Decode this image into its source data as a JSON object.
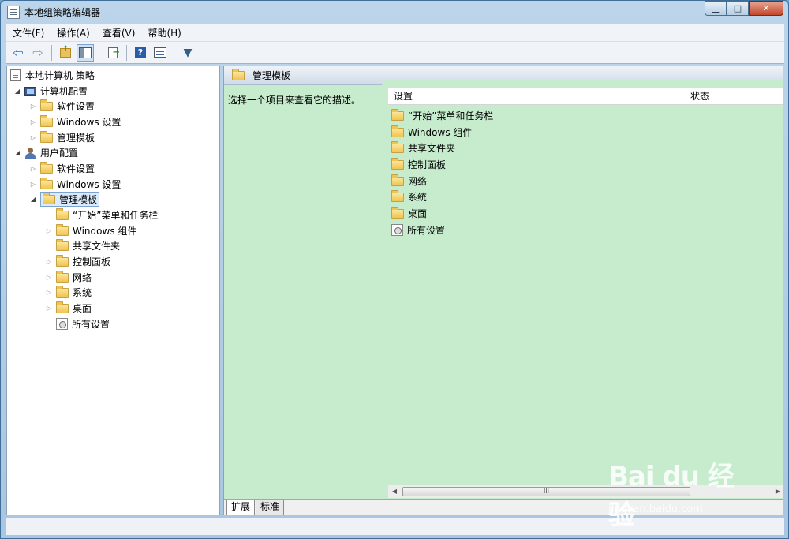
{
  "window": {
    "title": "本地组策略编辑器"
  },
  "titlebar": {
    "min": "▁",
    "max": "□",
    "close": "✕"
  },
  "menu": [
    {
      "label": "文件(F)"
    },
    {
      "label": "操作(A)"
    },
    {
      "label": "查看(V)"
    },
    {
      "label": "帮助(H)"
    }
  ],
  "toolbar": {
    "back": "⇦",
    "forward": "⇨",
    "filter": "▼"
  },
  "tree": {
    "root": "本地计算机 策略",
    "computer_config": "计算机配置",
    "cc_software": "软件设置",
    "cc_windows": "Windows 设置",
    "cc_admin": "管理模板",
    "user_config": "用户配置",
    "uc_software": "软件设置",
    "uc_windows": "Windows 设置",
    "uc_admin": "管理模板",
    "children": [
      {
        "label": "“开始”菜单和任务栏"
      },
      {
        "label": "Windows 组件"
      },
      {
        "label": "共享文件夹"
      },
      {
        "label": "控制面板"
      },
      {
        "label": "网络"
      },
      {
        "label": "系统"
      },
      {
        "label": "桌面"
      },
      {
        "label": "所有设置"
      }
    ]
  },
  "right": {
    "header_title": "管理模板",
    "description": "选择一个项目来查看它的描述。",
    "columns": {
      "setting": "设置",
      "state": "状态"
    },
    "items": [
      {
        "label": "“开始”菜单和任务栏"
      },
      {
        "label": "Windows 组件"
      },
      {
        "label": "共享文件夹"
      },
      {
        "label": "控制面板"
      },
      {
        "label": "网络"
      },
      {
        "label": "系统"
      },
      {
        "label": "桌面"
      },
      {
        "label": "所有设置"
      }
    ],
    "scroll_thumb": "III",
    "tabs": {
      "extended": "扩展",
      "standard": "标准"
    }
  },
  "watermark": {
    "brand": "Bai du 经验",
    "url": "jingyan.baidu.com"
  }
}
